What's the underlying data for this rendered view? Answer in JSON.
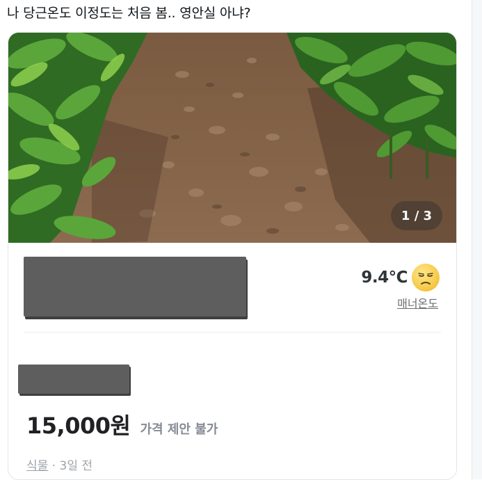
{
  "post": {
    "text": "나 당근온도 이정도는 처음 봄.. 영안실 아냐?"
  },
  "card": {
    "photo_counter": "1 / 3",
    "seller": {
      "temperature": "9.4℃",
      "manner_label": "매너온도",
      "face_icon": "sad-face-icon"
    },
    "price": "15,000원",
    "negotiation": "가격 제안 불가",
    "category": "식물",
    "separator": " · ",
    "time_ago": "3일 전"
  },
  "colors": {
    "manner_face": "#f5c542",
    "price_text": "#212124",
    "muted_text": "#868b94",
    "redaction": "#5e5e5e"
  }
}
